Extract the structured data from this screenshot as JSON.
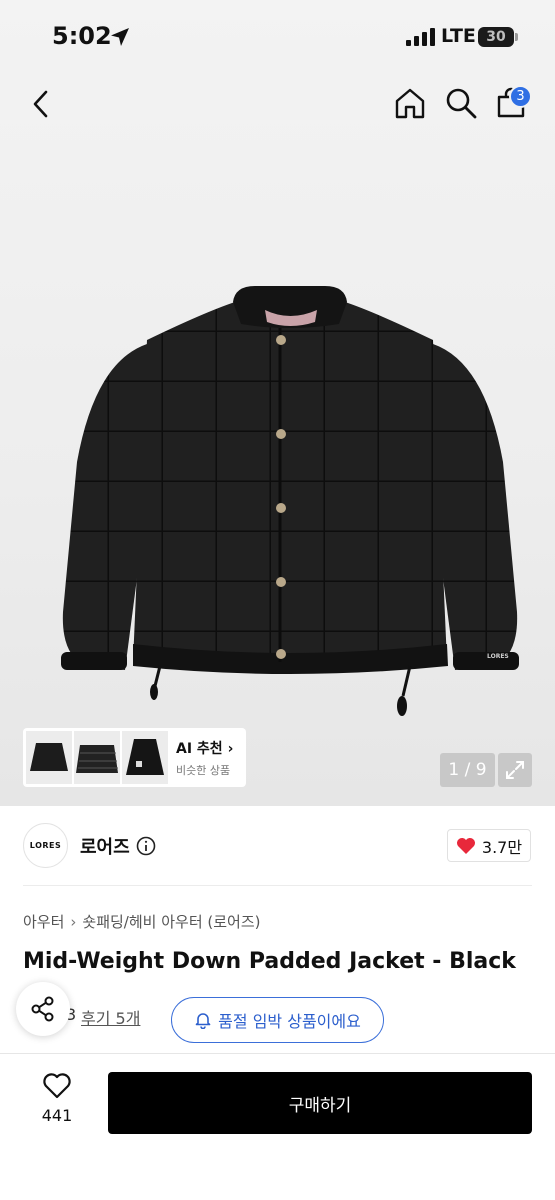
{
  "status_bar": {
    "time": "5:02",
    "network": "LTE",
    "battery": "30"
  },
  "nav": {
    "cart_count": "3"
  },
  "gallery": {
    "jacket_logo": "LORES",
    "ai_title": "AI 추천",
    "ai_subtitle": "비슷한 상품",
    "counter": "1 / 9"
  },
  "brand": {
    "logo_text": "LORES",
    "name": "로어즈",
    "likes": "3.7만"
  },
  "breadcrumb": {
    "level1": "아우터",
    "level2": "숏패딩/헤비 아우터 (로어즈)"
  },
  "product": {
    "title": "Mid-Weight Down Padded Jacket - Black",
    "rating_digit": "3",
    "reviews": "후기 5개",
    "stock_notice": "품절 임박 상품이에요"
  },
  "bottom_bar": {
    "wish_count": "441",
    "buy_label": "구매하기"
  },
  "colors": {
    "accent_blue": "#2f6fe4",
    "heart_red": "#e8283b",
    "buy_button": "#000000"
  }
}
